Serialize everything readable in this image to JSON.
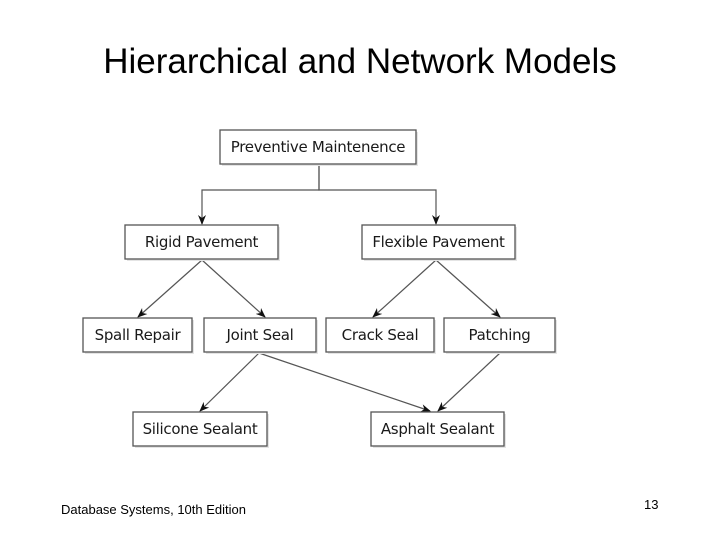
{
  "slide": {
    "title": "Hierarchical and Network Models",
    "footer": "Database Systems, 10th Edition",
    "page_number": "13"
  },
  "diagram": {
    "nodes": [
      {
        "id": "preventive",
        "label": "Preventive Maintenence"
      },
      {
        "id": "rigid",
        "label": "Rigid Pavement"
      },
      {
        "id": "flexible",
        "label": "Flexible Pavement"
      },
      {
        "id": "spall",
        "label": "Spall Repair"
      },
      {
        "id": "joint",
        "label": "Joint Seal"
      },
      {
        "id": "crack",
        "label": "Crack Seal"
      },
      {
        "id": "patching",
        "label": "Patching"
      },
      {
        "id": "silicone",
        "label": "Silicone Sealant"
      },
      {
        "id": "asphalt",
        "label": "Asphalt Sealant"
      }
    ],
    "edges": [
      {
        "from": "preventive",
        "to": "rigid"
      },
      {
        "from": "preventive",
        "to": "flexible"
      },
      {
        "from": "rigid",
        "to": "spall"
      },
      {
        "from": "rigid",
        "to": "joint"
      },
      {
        "from": "flexible",
        "to": "crack"
      },
      {
        "from": "flexible",
        "to": "patching"
      },
      {
        "from": "joint",
        "to": "silicone"
      },
      {
        "from": "joint",
        "to": "asphalt"
      },
      {
        "from": "patching",
        "to": "asphalt"
      }
    ]
  }
}
